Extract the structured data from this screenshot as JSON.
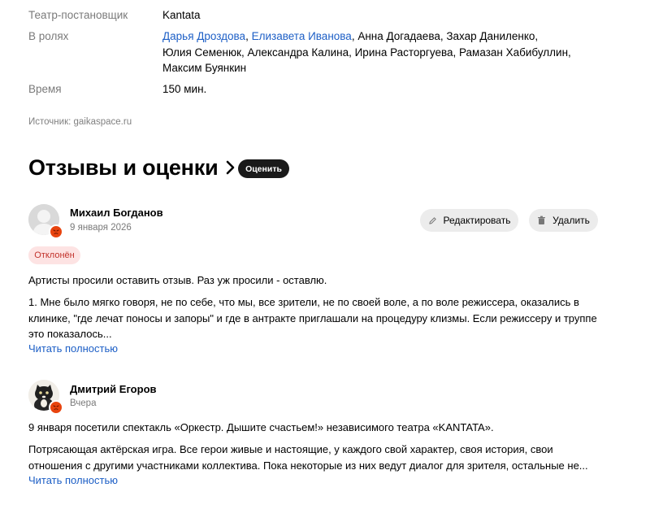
{
  "details": {
    "theatre_label": "Театр-постановщик",
    "theatre_value": "Kantata",
    "cast_label": "В ролях",
    "cast_link_1": "Дарья Дроздова",
    "cast_sep_1": ", ",
    "cast_link_2": "Елизавета Иванова",
    "cast_rest_line1": ", Анна Догадаева, Захар Даниленко,",
    "cast_line2": "Юлия Семенюк, Александра Калина, Ирина Расторгуева, Рамазан Хабибуллин,",
    "cast_line3": "Максим Буянкин",
    "time_label": "Время",
    "time_value": "150 мин."
  },
  "source": "Источник: gaikaspace.ru",
  "reviews_section": {
    "title": "Отзывы и оценки",
    "rate_button": "Оценить"
  },
  "reviews": [
    {
      "author": "Михаил Богданов",
      "date": "9 января 2026",
      "edit_label": "Редактировать",
      "delete_label": "Удалить",
      "status": "Отклонён",
      "paragraph_1": "Артисты просили оставить отзыв. Раз уж просили - оставлю.",
      "paragraph_2_line1": "1. Мне было мягко говоря, не по себе, что мы, все зрители, не по своей воле, а по воле режиссера, оказались в",
      "paragraph_2_line2": "клинике, \"где лечат поносы и запоры\" и где в антракте приглашали на процедуру клизмы. Если режиссеру и труппе",
      "paragraph_2_line3": "это показалось...",
      "read_more": "Читать полностью"
    },
    {
      "author": "Дмитрий Егоров",
      "date": "Вчера",
      "paragraph_1": "9 января посетили спектакль «Оркестр. Дышите счастьем!» независимого театра «KANTATA».",
      "paragraph_2_line1": "Потрясающая актёрская игра. Все герои живые и настоящие, у каждого свой характер, своя история, свои",
      "paragraph_2_line2": "отношения с другими участниками коллектива. Пока некоторые из них ведут диалог для зрителя, остальные не...",
      "read_more": "Читать полностью"
    }
  ],
  "icons": {
    "chevron": "chevron-right-icon",
    "pencil": "pencil-icon",
    "trash": "trash-icon",
    "angry_face": "angry-face-icon",
    "default_avatar": "user-silhouette-icon",
    "cat_avatar": "cat-photo-avatar"
  },
  "colors": {
    "link": "#1d5fc6",
    "muted": "#7a7a7a",
    "rate_button_bg": "#1a1a1a",
    "pill_bg": "#ececec",
    "status_bg": "#fde3e3",
    "status_text": "#c2322b",
    "badge_orange": "#e8440f"
  }
}
